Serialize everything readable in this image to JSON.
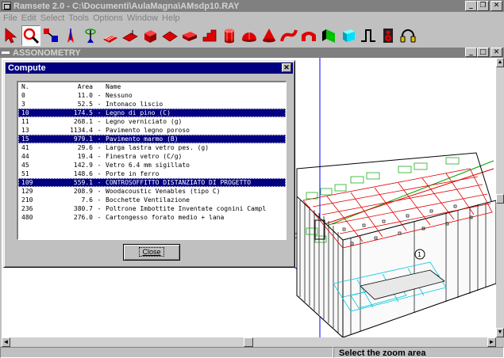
{
  "window": {
    "title": "Ramsete 2.0 - C:\\Documenti\\AulaMagna\\AMsdp10.RAY"
  },
  "menu": [
    "File",
    "Edit",
    "Select",
    "Tools",
    "Options",
    "Window",
    "Help"
  ],
  "toolbar": [
    "pointer-arrow-icon",
    "zoom-magnifier-icon",
    "select-objects-icon",
    "source-pointer-icon",
    "receiver-gizmo-icon",
    "striped-panel-icon",
    "red-plane-icon",
    "red-box-icon",
    "diamond-plate-icon",
    "red-slab-icon",
    "stair-icon",
    "cylinder-icon",
    "dome-icon",
    "cone-icon",
    "curved-pipe-icon",
    "arch-icon",
    "wall-shape-icon",
    "cyan-box-icon",
    "profile-line-icon",
    "speaker-icon",
    "headphones-icon"
  ],
  "mdi": {
    "title": "ASSONOMETRY"
  },
  "dialog": {
    "title": "Compute",
    "header": {
      "n": "N.",
      "area": "Area",
      "name": "Name"
    },
    "rows": [
      {
        "n": "0",
        "area": "11.0",
        "name": "Nessuno",
        "selected": false
      },
      {
        "n": "3",
        "area": "52.5",
        "name": "Intonaco liscio",
        "selected": false
      },
      {
        "n": "10",
        "area": "174.5",
        "name": "Legno di pino (C)",
        "selected": true
      },
      {
        "n": "11",
        "area": "268.1",
        "name": "Legno verniciato (g)",
        "selected": false
      },
      {
        "n": "13",
        "area": "1134.4",
        "name": "Pavimento legno poroso",
        "selected": false
      },
      {
        "n": "15",
        "area": "979.1",
        "name": "Pavimento marmo (B)",
        "selected": true
      },
      {
        "n": "41",
        "area": "29.6",
        "name": "Larga lastra vetro pes. (g)",
        "selected": false
      },
      {
        "n": "44",
        "area": "19.4",
        "name": "Finestra vetro (C/g)",
        "selected": false
      },
      {
        "n": "45",
        "area": "142.9",
        "name": "Vetro 6.4 mm sigillato",
        "selected": false
      },
      {
        "n": "51",
        "area": "148.6",
        "name": "Porte in ferro",
        "selected": false
      },
      {
        "n": "109",
        "area": "559.1",
        "name": "CONTROSOFFITTO DISTANZIATO DI PROGETTO",
        "selected": true
      },
      {
        "n": "129",
        "area": "208.9",
        "name": "Woodacoustic Venables (tipo C)",
        "selected": false
      },
      {
        "n": "210",
        "area": "7.6",
        "name": "Bocchette Ventilazione",
        "selected": false
      },
      {
        "n": "236",
        "area": "380.7",
        "name": "Poltrone Imbottite Inventate cognini Campl",
        "selected": false
      },
      {
        "n": "480",
        "area": "276.0",
        "name": "Cartongesso forato medio + lana",
        "selected": false
      }
    ],
    "close_label": "Close"
  },
  "status": {
    "text": "Select the zoom area"
  },
  "model_label": "1",
  "colors": {
    "selection": "#000080",
    "wire_red": "#e00000",
    "wire_green": "#00a000",
    "wire_cyan": "#00c8e0",
    "axis_blue": "#0000ff"
  }
}
